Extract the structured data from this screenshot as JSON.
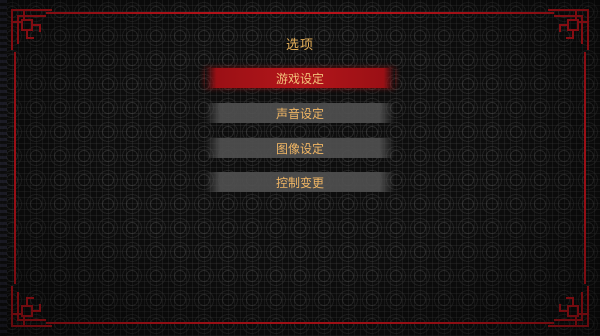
{
  "menu": {
    "title": "选项",
    "items": [
      {
        "label": "游戏设定",
        "selected": true
      },
      {
        "label": "声音设定",
        "selected": false
      },
      {
        "label": "图像设定",
        "selected": false
      },
      {
        "label": "控制变更",
        "selected": false
      }
    ]
  },
  "colors": {
    "frame": "#c8141c",
    "text": "#f1b664",
    "selected_bg": "#b3161b",
    "item_bg": "#505050"
  },
  "icons": [
    "corner-ornament-top-left",
    "corner-ornament-top-right",
    "corner-ornament-bottom-left",
    "corner-ornament-bottom-right"
  ]
}
